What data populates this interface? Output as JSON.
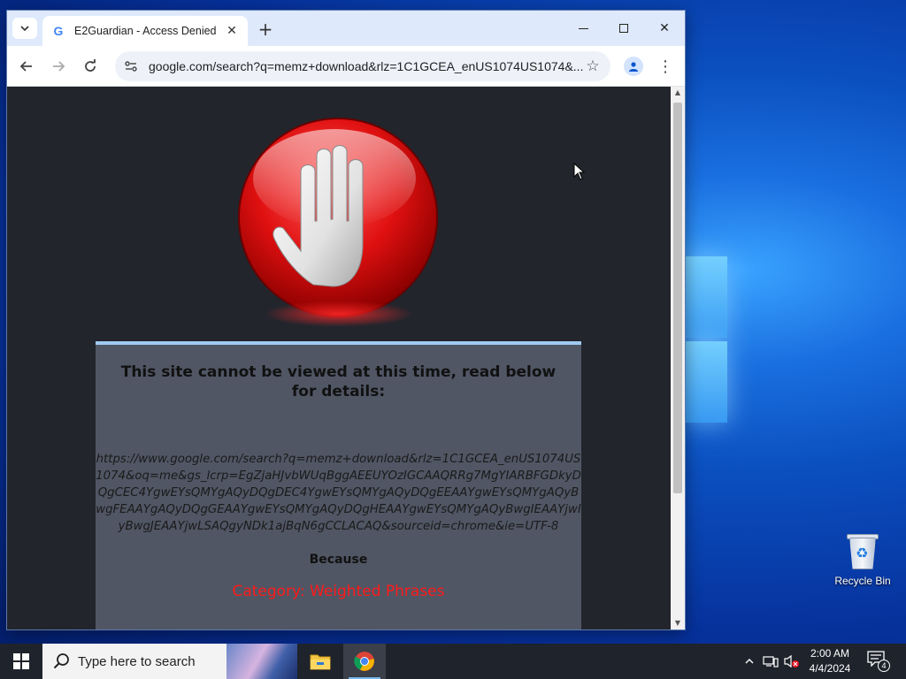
{
  "browser": {
    "tab": {
      "title": "E2Guardian - Access Denied",
      "favicon": "G"
    },
    "url": "google.com/search?q=memz+download&rlz=1C1GCEA_enUS1074US1074&...",
    "window_controls": [
      "minimize",
      "maximize",
      "close"
    ]
  },
  "page": {
    "heading": "This site cannot be viewed at this time, read below for details:",
    "blocked_url": "https://www.google.com/search?q=memz+download&rlz=1C1GCEA_enUS1074US1074&oq=me&gs_lcrp=EgZjaHJvbWUqBggAEEUYOzIGCAAQRRg7MgYIARBFGDkyDQgCEC4YgwEYsQMYgAQyDQgDEC4YgwEYsQMYgAQyDQgEEAAYgwEYsQMYgAQyBwgFEAAYgAQyDQgGEAAYgwEYsQMYgAQyDQgHEAAYgwEYsQMYgAQyBwgIEAAYjwIyBwgJEAAYjwLSAQgyNDk1ajBqN6gCCLACAQ&sourceid=chrome&ie=UTF-8",
    "because_label": "Because",
    "category": "Category: Weighted Phrases"
  },
  "desktop": {
    "recycle_bin_label": "Recycle Bin"
  },
  "taskbar": {
    "search_placeholder": "Type here to search",
    "time": "2:00 AM",
    "date": "4/4/2024",
    "notification_count": "4"
  },
  "colors": {
    "accent": "#9fcbf2",
    "category_red": "#ff1a1a",
    "page_bg": "#22252c",
    "panel_bg": "#505664"
  }
}
